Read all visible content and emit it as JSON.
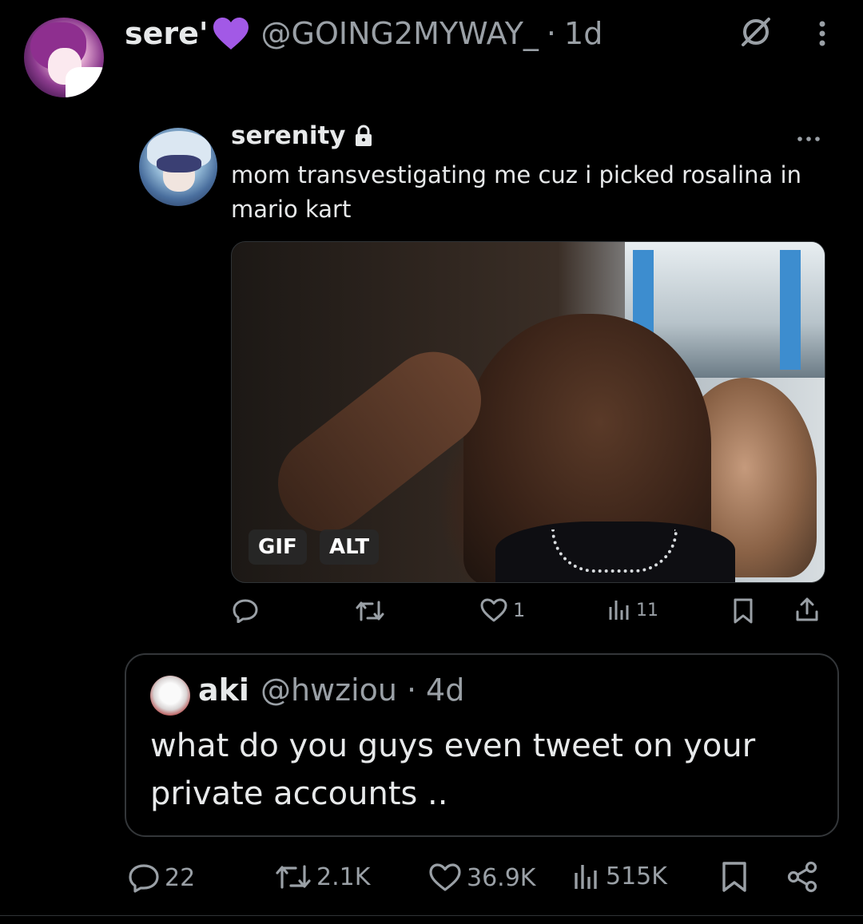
{
  "header": {
    "name": "sere'",
    "handle": "@GOING2MYWAY_",
    "separator": "·",
    "time": "1d"
  },
  "icons": {
    "emoji": "purple-heart",
    "top_right": [
      "no-entry-icon",
      "more-vertical-icon"
    ],
    "embed_more": "more-horizontal-icon",
    "lock": "lock-icon"
  },
  "embed": {
    "name": "serenity",
    "text": "mom transvestigating me cuz i picked rosalina in mario kart",
    "media_badges": {
      "gif": "GIF",
      "alt": "ALT"
    },
    "actions": {
      "reply_count": "",
      "repost_count": "",
      "like_count": "1",
      "views_count": "11"
    }
  },
  "quote": {
    "name": "aki",
    "handle": "@hwziou",
    "separator": "·",
    "time": "4d",
    "text": "what do you guys even tweet on your private accounts .."
  },
  "bottom_actions": {
    "replies": "22",
    "reposts": "2.1K",
    "likes": "36.9K",
    "views": "515K"
  },
  "colors": {
    "background": "#000000",
    "text_primary": "#e7e9ea",
    "text_secondary": "#9aa0a6",
    "border": "#333639",
    "heart_purple": "#a259e6"
  }
}
